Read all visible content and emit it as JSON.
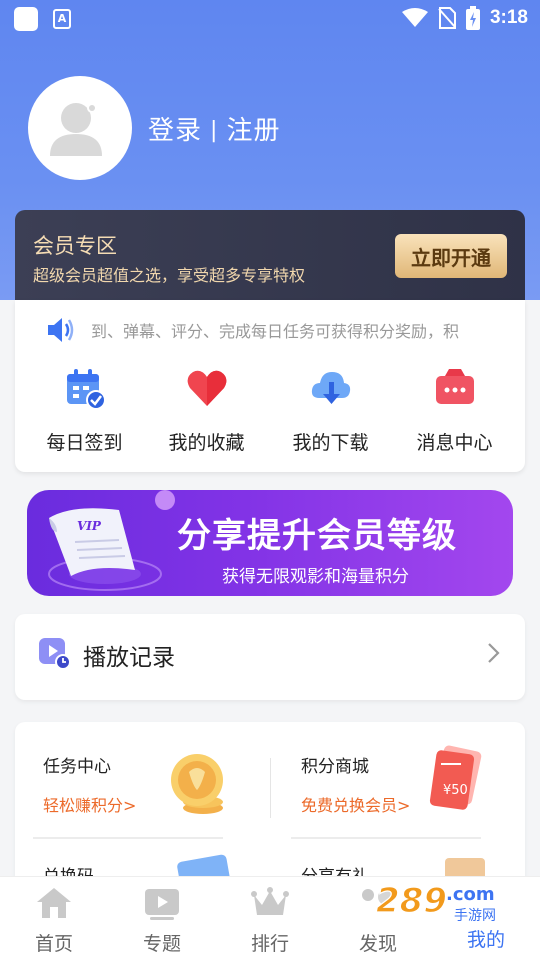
{
  "status_bar": {
    "time": "3:18"
  },
  "header": {
    "login": "登录",
    "separator": "|",
    "register": "注册"
  },
  "vip": {
    "title": "会员专区",
    "subtitle": "超级会员超值之选，享受超多专享特权",
    "button": "立即开通"
  },
  "notice": {
    "text": "到、弹幕、评分、完成每日任务可获得积分奖励，积"
  },
  "quick_actions": [
    {
      "label": "每日签到",
      "icon": "calendar-check-icon"
    },
    {
      "label": "我的收藏",
      "icon": "heart-icon"
    },
    {
      "label": "我的下载",
      "icon": "cloud-download-icon"
    },
    {
      "label": "消息中心",
      "icon": "message-icon"
    }
  ],
  "promo": {
    "title": "分享提升会员等级",
    "subtitle": "获得无限观影和海量积分",
    "badge": "VIP"
  },
  "play_record": {
    "label": "播放记录"
  },
  "services": [
    {
      "title": "任务中心",
      "subtitle": "轻松赚积分>"
    },
    {
      "title": "积分商城",
      "subtitle": "免费兑换会员>",
      "coupon": "¥50"
    },
    {
      "title": "兑换码"
    },
    {
      "title": "分享有礼"
    }
  ],
  "tabs": [
    {
      "label": "首页"
    },
    {
      "label": "专题"
    },
    {
      "label": "排行"
    },
    {
      "label": "发现"
    },
    {
      "label": "我的"
    }
  ],
  "watermark": {
    "text": "289",
    "suffix": ".com",
    "sub": "手游网"
  },
  "colors": {
    "accent": "#3d74f2",
    "header": "#5f86f0",
    "vip_gold": "#f5dcb4",
    "promo_purple": "#7a2fe4",
    "orange": "#ec6a2a"
  }
}
